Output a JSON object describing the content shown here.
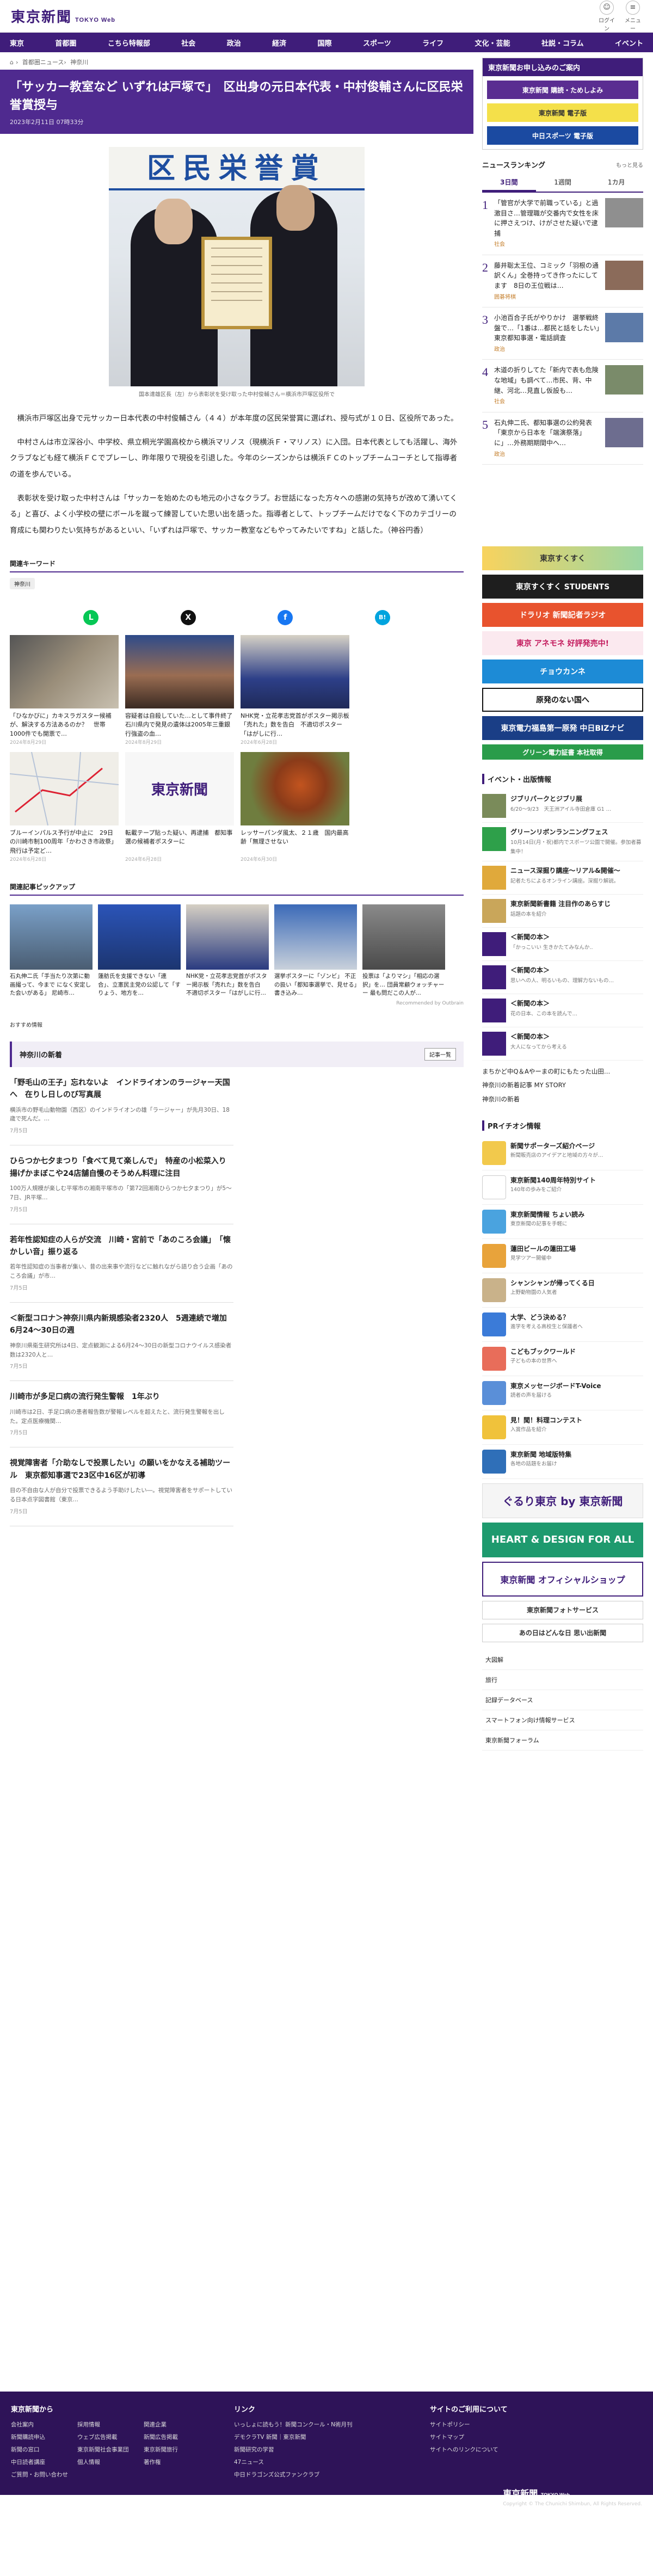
{
  "site": {
    "logo": "東京新聞",
    "logo_sub": "TOKYO Web",
    "tool_login": "ログイン",
    "tool_menu": "メニュー"
  },
  "nav": [
    "東京",
    "首都圏",
    "こちら特報部",
    "社会",
    "政治",
    "経済",
    "国際",
    "スポーツ",
    "ライフ",
    "文化・芸能",
    "社説・コラム",
    "イベント"
  ],
  "breadcrumb": [
    "首都圏ニュース",
    "神奈川"
  ],
  "article": {
    "title": "「サッカー教室など いずれは戸塚で」　区出身の元日本代表・中村俊輔さんに区民栄誉賞授与",
    "date": "2023年2月11日 07時33分",
    "banner": "区民栄誉賞",
    "caption": "国本達雄区長（左）から表彰状を受け取った中村俊輔さん＝横浜市戸塚区役所で",
    "paragraphs": [
      "横浜市戸塚区出身で元サッカー日本代表の中村俊輔さん（４４）が本年度の区民栄誉賞に選ばれ、授与式が１０日、区役所であった。",
      "中村さんは市立深谷小、中学校、県立桐光学園高校から横浜マリノス（現横浜Ｆ・マリノス）に入団。日本代表としても活躍し、海外クラブなども経て横浜ＦＣでプレーし、昨年限りで現役を引退した。今年のシーズンからは横浜ＦＣのトップチームコーチとして指導者の道を歩んでいる。",
      "表彰状を受け取った中村さんは「サッカーを始めたのも地元の小さなクラブ。お世話になった方々への感謝の気持ちが改めて湧いてくる」と喜び、よく小学校の壁にボールを蹴って練習していた思い出を語った。指導者として、トップチームだけでなく下のカテゴリーの育成にも関わりたい気持ちがあるといい、「いずれは戸塚で、サッカー教室などもやってみたいですね」と話した。（神谷円香）"
    ]
  },
  "keywords": {
    "heading": "関連キーワード",
    "items": [
      "神奈川"
    ]
  },
  "share": {
    "line": "L",
    "x": "X",
    "facebook": "f",
    "hatena": "B!"
  },
  "related": [
    {
      "title": "「ひなかびに」カキスラガスター候補が、解決する方法あるのか？　世帯1000件でも開票で…",
      "date": "2024年8月29日"
    },
    {
      "title": "容疑者は自殺していた…として事件終了　石川県内で発見の遺体は2005年三重銀行強盗の血…",
      "date": "2024年8月29日"
    },
    {
      "title": "NHK党・立花孝志党首がポスター掲示板「売れた」数を告白　不適切ポスター「はがしに行…",
      "date": "2024年6月28日"
    },
    {
      "title": "ブルーインパルス予行が中止に　29日の川崎市制100周年「かわさき市政祭」飛行は予定ど…",
      "date": "2024年6月28日"
    },
    {
      "title": "転載テープ貼った疑い、再逮捕　都知事選の候補者ポスターに",
      "date": "2024年6月28日"
    },
    {
      "title": "レッサーパンダ風太、２１歳　国内最高齢「無理させない",
      "date": "2024年6月30日"
    }
  ],
  "pickup": {
    "heading": "関連記事ピックアップ",
    "items": [
      "石丸伸二氏「手当たり次第に動画撮って、今まで になく安定した会いがある」 尼崎市…",
      "蓮舫氏を支援できない「連合」、立憲民主党の公認して「すりょう、地方を…",
      "NHK党・立花孝志党首がポスター掲示板「売れた」数を告白　不適切ポスター「はがしに行…",
      "選挙ポスターに「ゾンビ」 不正の扱い「都知事選挙で、見せる」書き込み…",
      "投票は「よりマシ」「相応の選択」を… 団員常顧ウォッチャーー 最も問だこの人が..."
    ],
    "credit": "Recommended by Outbrain"
  },
  "recommend": {
    "label": "おすすめ情報",
    "heading": "神奈川の新着",
    "more": "記事一覧",
    "items": [
      {
        "title": "「野毛山の王子」忘れないよ　インドライオンのラージャー天国へ　在りし日しのび写真展",
        "desc": "横浜市の野毛山動物園（西区）のインドライオンの雄「ラージャー」が先月30日、18歳で死んだ。…",
        "date": "7月5日"
      },
      {
        "title": "ひらつか七夕まつり「食べて見て楽しんで」　特産の小松菜入り揚げかまぼこや24店舗自慢のそうめん料理に注目",
        "desc": "100万人規模が楽しむ平塚市の湘南平塚市の「第72回湘南ひらつか七夕まつり」が5〜7日、JR平塚…",
        "date": "7月5日"
      },
      {
        "title": "若年性認知症の人らが交流　川崎・宮前で「あのころ会議」　「懐かしい音」振り返る",
        "desc": "若年性認知症の当事者が集い、昔の出来事や流行などに触れながら語り合う企画「あのころ会議」が市…",
        "date": "7月5日"
      },
      {
        "title": "＜新型コロナ＞神奈川県内新規感染者2320人　5週連続で増加　6月24〜30日の週",
        "desc": "神奈川県衛生研究所は4日、定点観測による6月24〜30日の新型コロナウイルス感染者数は2320人と…",
        "date": "7月5日"
      },
      {
        "title": "川崎市が多足口病の流行発生警報　1年ぶり",
        "desc": "川崎市は2日、手足口病の患者報告数が警報レベルを超えたと、流行発生警報を出した。定点医療機関…",
        "date": "7月5日"
      },
      {
        "title": "視覚障害者「介助なしで投票したい」の願いをかなえる補助ツール　東京都知事選で23区中16区が初導",
        "desc": "目の不自由な人が自分で投票できるよう手助けしたい―。視覚障害者をサポートしている日本点字図書館（東京…",
        "date": "7月5日"
      }
    ]
  },
  "sidebar": {
    "news_box": {
      "heading": "東京新聞お申し込みのご案内",
      "items": [
        "東京新聞 購読・ためしよみ",
        "東京新聞 電子版",
        "中日スポーツ 電子版"
      ],
      "login": "ログイン"
    },
    "ranking": {
      "heading": "ニュースランキング",
      "more": "もっと見る",
      "tabs": [
        "3日間",
        "1週間",
        "1カ月"
      ],
      "items": [
        {
          "title": "「管官が大学で前職っている」と過激目さ…管理職が交番内で女性を床に押さえつけ、けがさせた疑いで逮捕",
          "cat": "社会"
        },
        {
          "title": "藤井聡太王位、コミック「羽根の通訳くん」全巻持ってき作ったにしてます　8日の王位戦は…",
          "cat": "囲碁将棋"
        },
        {
          "title": "小池百合子氏がやりかけ　選挙戦終盤で…「1番は…都民と話をしたい」東京都知事選・電話調査",
          "cat": "政治"
        },
        {
          "title": "木道の折りしてた「新内で表も危険な地域」も調べて…市民、背、中継、河北…見直し仮設も…",
          "cat": "社会"
        },
        {
          "title": "石丸伸二氏、都知事選の公約発表「東京から日本を「端演祭落」に」…外務期期間中へ…",
          "cat": "政治"
        }
      ]
    },
    "side_ads": [
      "東京すくすく",
      "東京すくすく STUDENTS",
      "ドラリオ 新聞記者ラジオ",
      "東京 アネモネ 好評発売中!",
      "チョウカンネ",
      "原発のない国へ",
      "東京電力福島第一原発 中日BIZナビ",
      "グリーン電力証書 本社取得"
    ],
    "events": {
      "heading": "イベント・出版情報",
      "items": [
        {
          "title": "ジブリパークとジブリ展",
          "desc": "6/20〜9/23　天王洲アイル寺田倉庫 G1 …"
        },
        {
          "title": "グリーンリボンランニングフェス",
          "desc": "10月14日(月・祝)都内でスポーツ公園で開催。参加者募集中！"
        },
        {
          "title": "ニュース深掘り講座〜リアル&開催〜",
          "desc": "記者たちによるオンライン講座。深掘り解説。"
        },
        {
          "title": "東京新聞新書籍 注目作のあらすじ",
          "desc": "話題の本を紹介"
        },
        {
          "title": "＜新聞の本＞",
          "desc": "「かっこいい 生きかたてみなんか.."
        },
        {
          "title": "＜新聞の本＞",
          "desc": "思いへの人、明るいもの、理解力ないもの…"
        },
        {
          "title": "＜新聞の本＞",
          "desc": "花の日本、この本を読んで…"
        },
        {
          "title": "＜新聞の本＞",
          "desc": "大人になってから考える"
        }
      ],
      "links": [
        "まちかど中Q＆Aやーまの町にもたった山田…",
        "神奈川の新着記事 MY STORY",
        "神奈川の新着"
      ]
    },
    "pr": {
      "heading": "PRイチオシ情報",
      "items": [
        {
          "title": "新聞サポーターズ紹介ページ",
          "desc": "新聞販売店のアイデアと地域の方々が…"
        },
        {
          "title": "東京新聞140周年特別サイト",
          "desc": "140年の歩みをご紹介"
        },
        {
          "title": "東京新聞情報 ちょい読み",
          "desc": "東京新聞の記事を手軽に"
        },
        {
          "title": "蓮田ビールの蓮田工場",
          "desc": "見学ツアー開催中"
        },
        {
          "title": "シャンシャンが帰ってくる日",
          "desc": "上野動物園の人気者"
        },
        {
          "title": "大学、どう決める？",
          "desc": "進学を考える高校生と保護者へ"
        },
        {
          "title": "こどもブックワールド",
          "desc": "子どもの本の世界へ"
        },
        {
          "title": "東京メッセージボードT-Voice",
          "desc": "読者の声を届ける"
        },
        {
          "title": "見！聞！料理コンテスト",
          "desc": "入賞作品を紹介"
        },
        {
          "title": "東京新聞 地域版特集",
          "desc": "各地の話題をお届け"
        }
      ],
      "banners": [
        "ぐるり東京 by 東京新聞",
        "HEART & DESIGN FOR ALL",
        "東京新聞 オフィシャルショップ",
        "東京新聞フォトサービス",
        "あの日はどんな日 思い出新聞"
      ],
      "links": [
        "大図解",
        "旅行",
        "記録データベース",
        "スマートフォン向け情報サービス",
        "東京新聞フォーラム"
      ]
    }
  },
  "footer": {
    "col1": {
      "heading": "東京新聞から",
      "a": [
        "会社案内",
        "新聞購読申込",
        "新聞の窓口",
        "中日読者講座",
        "ご質問・お問い合わせ"
      ],
      "b": [
        "採用情報",
        "ウェブ広告掲載",
        "東京新聞社会事業団",
        "個人情報"
      ],
      "c": [
        "関連企業",
        "新聞広告掲載",
        "東京新聞旅行",
        "著作権"
      ]
    },
    "col2": {
      "heading": "リンク",
      "items": [
        "いっしょに読もう！新聞コンクール・N術月刊",
        "デモクラTV 新聞｜東京新聞",
        "新聞研究の学習",
        "47ニュース",
        "中日ドラゴンズ公式ファンクラブ"
      ]
    },
    "col3": {
      "heading": "サイトのご利用について",
      "items": [
        "サイトポリシー",
        "サイトマップ",
        "サイトへのリンクについて"
      ]
    },
    "logo": "東京新聞",
    "logo_sub": "TOKYO Web",
    "copyright": "Copyright © The Chunichi Shimbun, All Rights Reserved."
  }
}
